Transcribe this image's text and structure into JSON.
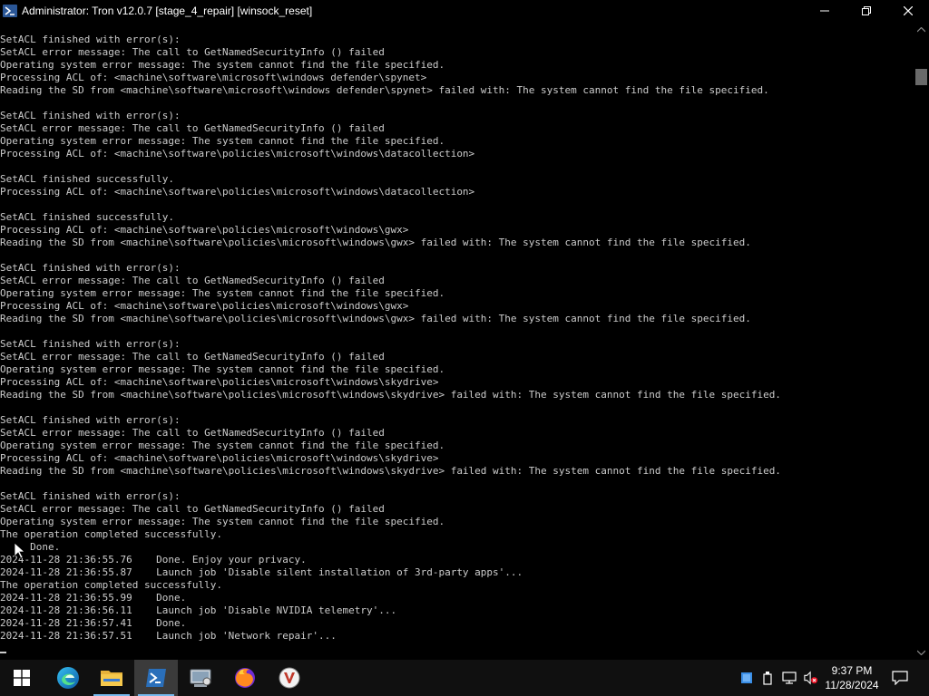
{
  "window": {
    "title": "Administrator:  Tron v12.0.7 [stage_4_repair] [winsock_reset]"
  },
  "console": {
    "lines": [
      "SetACL finished with error(s):",
      "SetACL error message: The call to GetNamedSecurityInfo () failed",
      "Operating system error message: The system cannot find the file specified.",
      "Processing ACL of: <machine\\software\\microsoft\\windows defender\\spynet>",
      "Reading the SD from <machine\\software\\microsoft\\windows defender\\spynet> failed with: The system cannot find the file specified.",
      "",
      "SetACL finished with error(s):",
      "SetACL error message: The call to GetNamedSecurityInfo () failed",
      "Operating system error message: The system cannot find the file specified.",
      "Processing ACL of: <machine\\software\\policies\\microsoft\\windows\\datacollection>",
      "",
      "SetACL finished successfully.",
      "Processing ACL of: <machine\\software\\policies\\microsoft\\windows\\datacollection>",
      "",
      "SetACL finished successfully.",
      "Processing ACL of: <machine\\software\\policies\\microsoft\\windows\\gwx>",
      "Reading the SD from <machine\\software\\policies\\microsoft\\windows\\gwx> failed with: The system cannot find the file specified.",
      "",
      "SetACL finished with error(s):",
      "SetACL error message: The call to GetNamedSecurityInfo () failed",
      "Operating system error message: The system cannot find the file specified.",
      "Processing ACL of: <machine\\software\\policies\\microsoft\\windows\\gwx>",
      "Reading the SD from <machine\\software\\policies\\microsoft\\windows\\gwx> failed with: The system cannot find the file specified.",
      "",
      "SetACL finished with error(s):",
      "SetACL error message: The call to GetNamedSecurityInfo () failed",
      "Operating system error message: The system cannot find the file specified.",
      "Processing ACL of: <machine\\software\\policies\\microsoft\\windows\\skydrive>",
      "Reading the SD from <machine\\software\\policies\\microsoft\\windows\\skydrive> failed with: The system cannot find the file specified.",
      "",
      "SetACL finished with error(s):",
      "SetACL error message: The call to GetNamedSecurityInfo () failed",
      "Operating system error message: The system cannot find the file specified.",
      "Processing ACL of: <machine\\software\\policies\\microsoft\\windows\\skydrive>",
      "Reading the SD from <machine\\software\\policies\\microsoft\\windows\\skydrive> failed with: The system cannot find the file specified.",
      "",
      "SetACL finished with error(s):",
      "SetACL error message: The call to GetNamedSecurityInfo () failed",
      "Operating system error message: The system cannot find the file specified.",
      "The operation completed successfully.",
      "     Done.",
      "2024-11-28 21:36:55.76    Done. Enjoy your privacy.",
      "2024-11-28 21:36:55.87    Launch job 'Disable silent installation of 3rd-party apps'...",
      "The operation completed successfully.",
      "2024-11-28 21:36:55.99    Done.",
      "2024-11-28 21:36:56.11    Launch job 'Disable NVIDIA telemetry'...",
      "2024-11-28 21:36:57.41    Done.",
      "2024-11-28 21:36:57.51    Launch job 'Network repair'..."
    ]
  },
  "taskbar": {
    "apps": [
      {
        "name": "edge-app",
        "active": false
      },
      {
        "name": "file-explorer-app",
        "active": false
      },
      {
        "name": "powershell-app",
        "active": true
      },
      {
        "name": "hardware-app",
        "active": false
      },
      {
        "name": "firefox-app",
        "active": false
      },
      {
        "name": "vivaldi-app",
        "active": false
      }
    ],
    "tray_icons": [
      "network-drive-icon",
      "usb-device-icon",
      "network-icon",
      "volume-muted-icon"
    ],
    "clock": {
      "time": "9:37 PM",
      "date": "11/28/2024"
    }
  },
  "colors": {
    "console_bg": "#000000",
    "console_text": "#cccccc",
    "taskbar_bg": "#101010",
    "active_indicator": "#76b9ed"
  }
}
